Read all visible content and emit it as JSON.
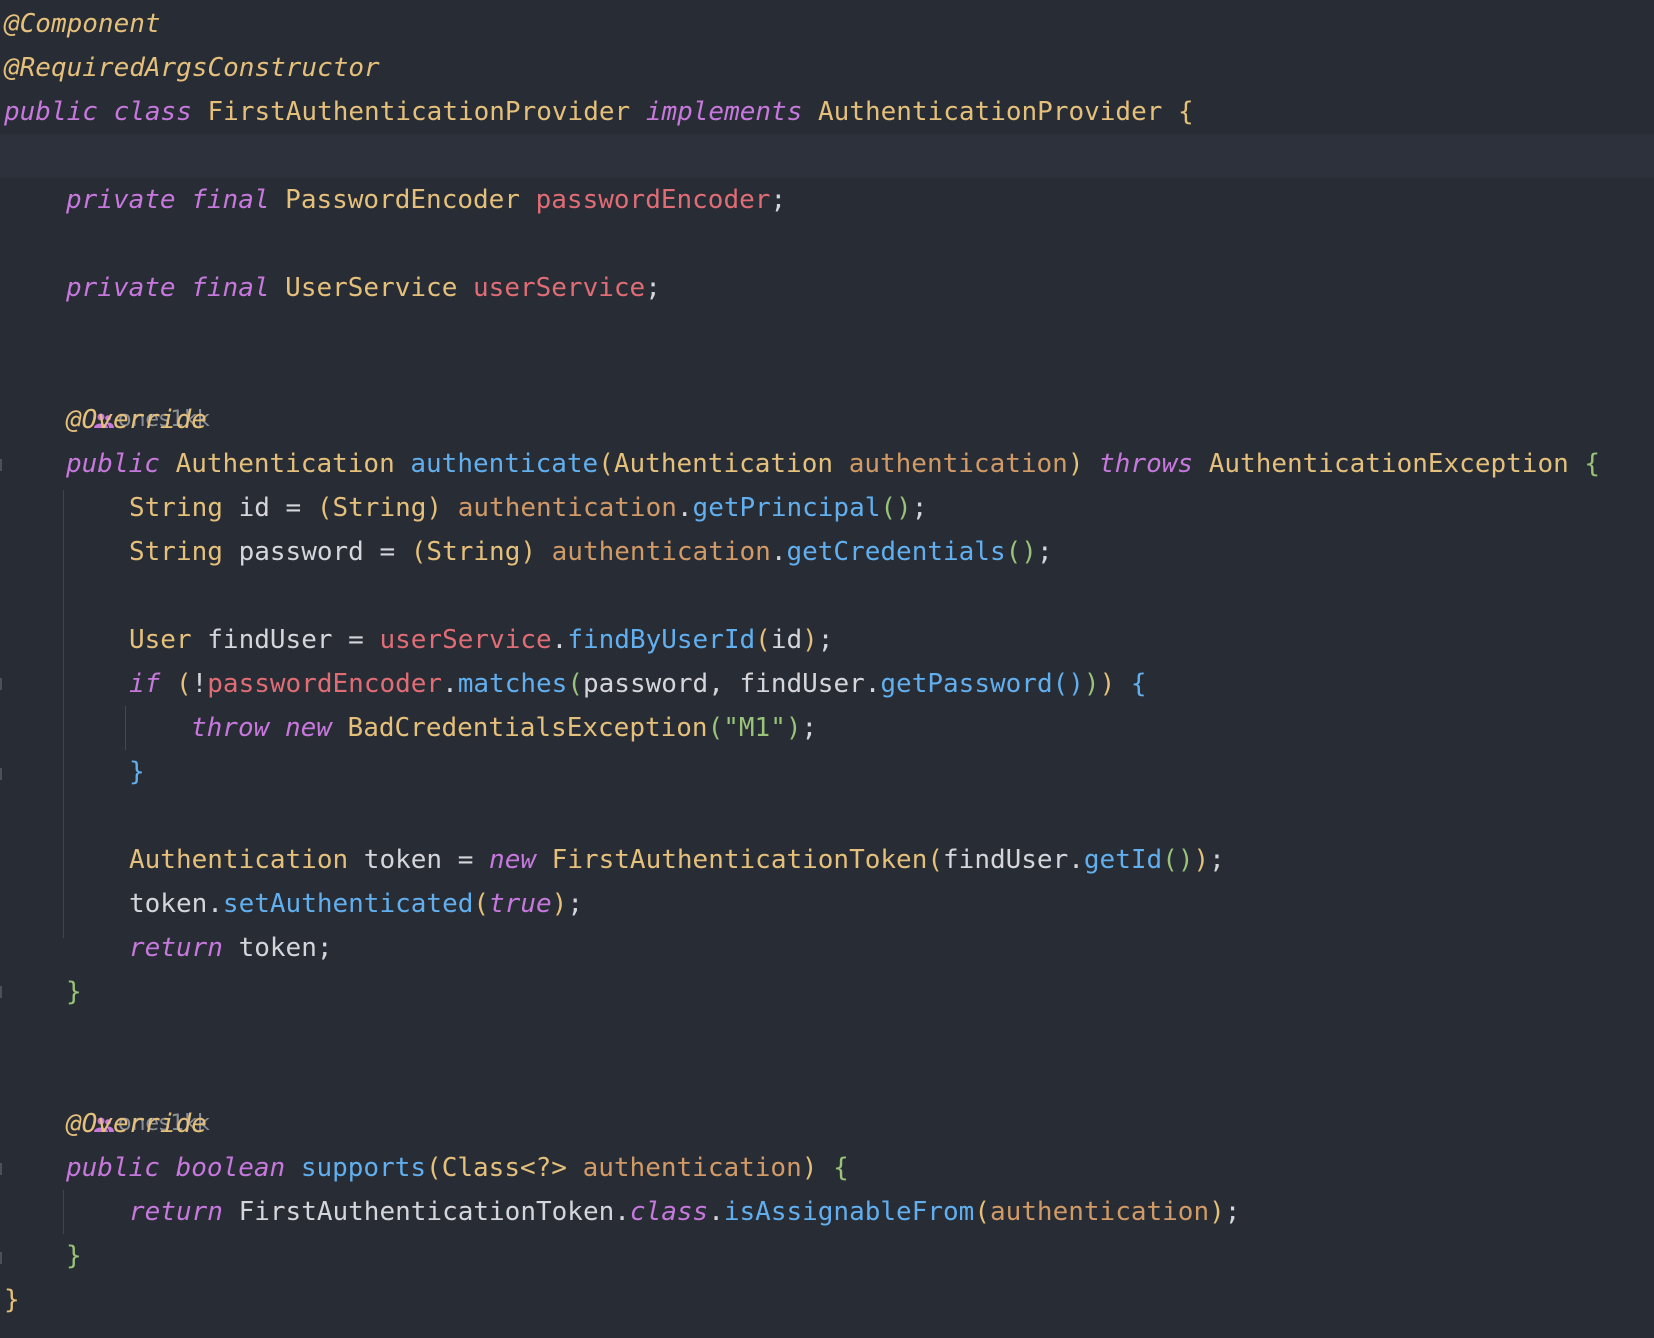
{
  "editor": {
    "author_hint": "ones1kk",
    "lines": {
      "l1": "@Component",
      "l2": "@RequiredArgsConstructor",
      "l3": [
        {
          "t": "public",
          "c": "kw"
        },
        {
          "t": " ",
          "c": "plain"
        },
        {
          "t": "class",
          "c": "kw"
        },
        {
          "t": " FirstAuthenticationProvider ",
          "c": "type"
        },
        {
          "t": "implements",
          "c": "kw"
        },
        {
          "t": " AuthenticationProvider ",
          "c": "type"
        },
        {
          "t": "{",
          "c": "b1"
        }
      ],
      "l5": [
        {
          "t": "private",
          "c": "kw"
        },
        {
          "t": " ",
          "c": "plain"
        },
        {
          "t": "final",
          "c": "kw"
        },
        {
          "t": " PasswordEncoder ",
          "c": "type"
        },
        {
          "t": "passwordEncoder",
          "c": "field"
        },
        {
          "t": ";",
          "c": "plain"
        }
      ],
      "l7": [
        {
          "t": "private",
          "c": "kw"
        },
        {
          "t": " ",
          "c": "plain"
        },
        {
          "t": "final",
          "c": "kw"
        },
        {
          "t": " UserService ",
          "c": "type"
        },
        {
          "t": "userService",
          "c": "field"
        },
        {
          "t": ";",
          "c": "plain"
        }
      ],
      "l9": "@Override",
      "l10": [
        {
          "t": "public",
          "c": "kw"
        },
        {
          "t": " Authentication ",
          "c": "type"
        },
        {
          "t": "authenticate",
          "c": "method"
        },
        {
          "t": "(",
          "c": "b1"
        },
        {
          "t": "Authentication ",
          "c": "type"
        },
        {
          "t": "authentication",
          "c": "param"
        },
        {
          "t": ")",
          "c": "b1"
        },
        {
          "t": " ",
          "c": "plain"
        },
        {
          "t": "throws",
          "c": "kw"
        },
        {
          "t": " AuthenticationException ",
          "c": "type"
        },
        {
          "t": "{",
          "c": "b2"
        }
      ],
      "l11": [
        {
          "t": "String",
          "c": "type"
        },
        {
          "t": " id = ",
          "c": "plain"
        },
        {
          "t": "(",
          "c": "b1"
        },
        {
          "t": "String",
          "c": "type"
        },
        {
          "t": ")",
          "c": "b1"
        },
        {
          "t": " ",
          "c": "plain"
        },
        {
          "t": "authentication",
          "c": "param"
        },
        {
          "t": ".",
          "c": "plain"
        },
        {
          "t": "getPrincipal",
          "c": "method"
        },
        {
          "t": "()",
          "c": "b2"
        },
        {
          "t": ";",
          "c": "plain"
        }
      ],
      "l12": [
        {
          "t": "String",
          "c": "type"
        },
        {
          "t": " password = ",
          "c": "plain"
        },
        {
          "t": "(",
          "c": "b1"
        },
        {
          "t": "String",
          "c": "type"
        },
        {
          "t": ")",
          "c": "b1"
        },
        {
          "t": " ",
          "c": "plain"
        },
        {
          "t": "authentication",
          "c": "param"
        },
        {
          "t": ".",
          "c": "plain"
        },
        {
          "t": "getCredentials",
          "c": "method"
        },
        {
          "t": "()",
          "c": "b2"
        },
        {
          "t": ";",
          "c": "plain"
        }
      ],
      "l14": [
        {
          "t": "User",
          "c": "type"
        },
        {
          "t": " findUser = ",
          "c": "plain"
        },
        {
          "t": "userService",
          "c": "field"
        },
        {
          "t": ".",
          "c": "plain"
        },
        {
          "t": "findByUserId",
          "c": "method"
        },
        {
          "t": "(",
          "c": "b1"
        },
        {
          "t": "id",
          "c": "plain"
        },
        {
          "t": ")",
          "c": "b1"
        },
        {
          "t": ";",
          "c": "plain"
        }
      ],
      "l15": [
        {
          "t": "if",
          "c": "kw"
        },
        {
          "t": " ",
          "c": "plain"
        },
        {
          "t": "(",
          "c": "b1"
        },
        {
          "t": "!",
          "c": "plain"
        },
        {
          "t": "passwordEncoder",
          "c": "field"
        },
        {
          "t": ".",
          "c": "plain"
        },
        {
          "t": "matches",
          "c": "method"
        },
        {
          "t": "(",
          "c": "b2"
        },
        {
          "t": "password, findUser.",
          "c": "plain"
        },
        {
          "t": "getPassword",
          "c": "method"
        },
        {
          "t": "()",
          "c": "b3"
        },
        {
          "t": ")",
          "c": "b2"
        },
        {
          "t": ")",
          "c": "b1"
        },
        {
          "t": " ",
          "c": "plain"
        },
        {
          "t": "{",
          "c": "b3"
        }
      ],
      "l16": [
        {
          "t": "throw",
          "c": "kw"
        },
        {
          "t": " ",
          "c": "plain"
        },
        {
          "t": "new",
          "c": "kw"
        },
        {
          "t": " BadCredentialsException",
          "c": "type"
        },
        {
          "t": "(",
          "c": "b2"
        },
        {
          "t": "\"M1\"",
          "c": "str"
        },
        {
          "t": ")",
          "c": "b2"
        },
        {
          "t": ";",
          "c": "plain"
        }
      ],
      "l17": "}",
      "l19": [
        {
          "t": "Authentication",
          "c": "type"
        },
        {
          "t": " token = ",
          "c": "plain"
        },
        {
          "t": "new",
          "c": "kw"
        },
        {
          "t": " FirstAuthenticationToken",
          "c": "type"
        },
        {
          "t": "(",
          "c": "b1"
        },
        {
          "t": "findUser.",
          "c": "plain"
        },
        {
          "t": "getId",
          "c": "method"
        },
        {
          "t": "()",
          "c": "b2"
        },
        {
          "t": ")",
          "c": "b1"
        },
        {
          "t": ";",
          "c": "plain"
        }
      ],
      "l20": [
        {
          "t": "token.",
          "c": "plain"
        },
        {
          "t": "setAuthenticated",
          "c": "method"
        },
        {
          "t": "(",
          "c": "b1"
        },
        {
          "t": "true",
          "c": "kw"
        },
        {
          "t": ")",
          "c": "b1"
        },
        {
          "t": ";",
          "c": "plain"
        }
      ],
      "l21": [
        {
          "t": "return",
          "c": "kw"
        },
        {
          "t": " token;",
          "c": "plain"
        }
      ],
      "l22": "}",
      "l24": "@Override",
      "l25": [
        {
          "t": "public",
          "c": "kw"
        },
        {
          "t": " ",
          "c": "plain"
        },
        {
          "t": "boolean",
          "c": "kw"
        },
        {
          "t": " ",
          "c": "plain"
        },
        {
          "t": "supports",
          "c": "method"
        },
        {
          "t": "(",
          "c": "b1"
        },
        {
          "t": "Class<?> ",
          "c": "type"
        },
        {
          "t": "authentication",
          "c": "param"
        },
        {
          "t": ")",
          "c": "b1"
        },
        {
          "t": " ",
          "c": "plain"
        },
        {
          "t": "{",
          "c": "b2"
        }
      ],
      "l26": [
        {
          "t": "return",
          "c": "kw"
        },
        {
          "t": " FirstAuthenticationToken.",
          "c": "plain"
        },
        {
          "t": "class",
          "c": "kw"
        },
        {
          "t": ".",
          "c": "plain"
        },
        {
          "t": "isAssignableFrom",
          "c": "method"
        },
        {
          "t": "(",
          "c": "b1"
        },
        {
          "t": "authentication",
          "c": "param"
        },
        {
          "t": ")",
          "c": "b1"
        },
        {
          "t": ";",
          "c": "plain"
        }
      ],
      "l27": "}",
      "l28": "}"
    }
  }
}
